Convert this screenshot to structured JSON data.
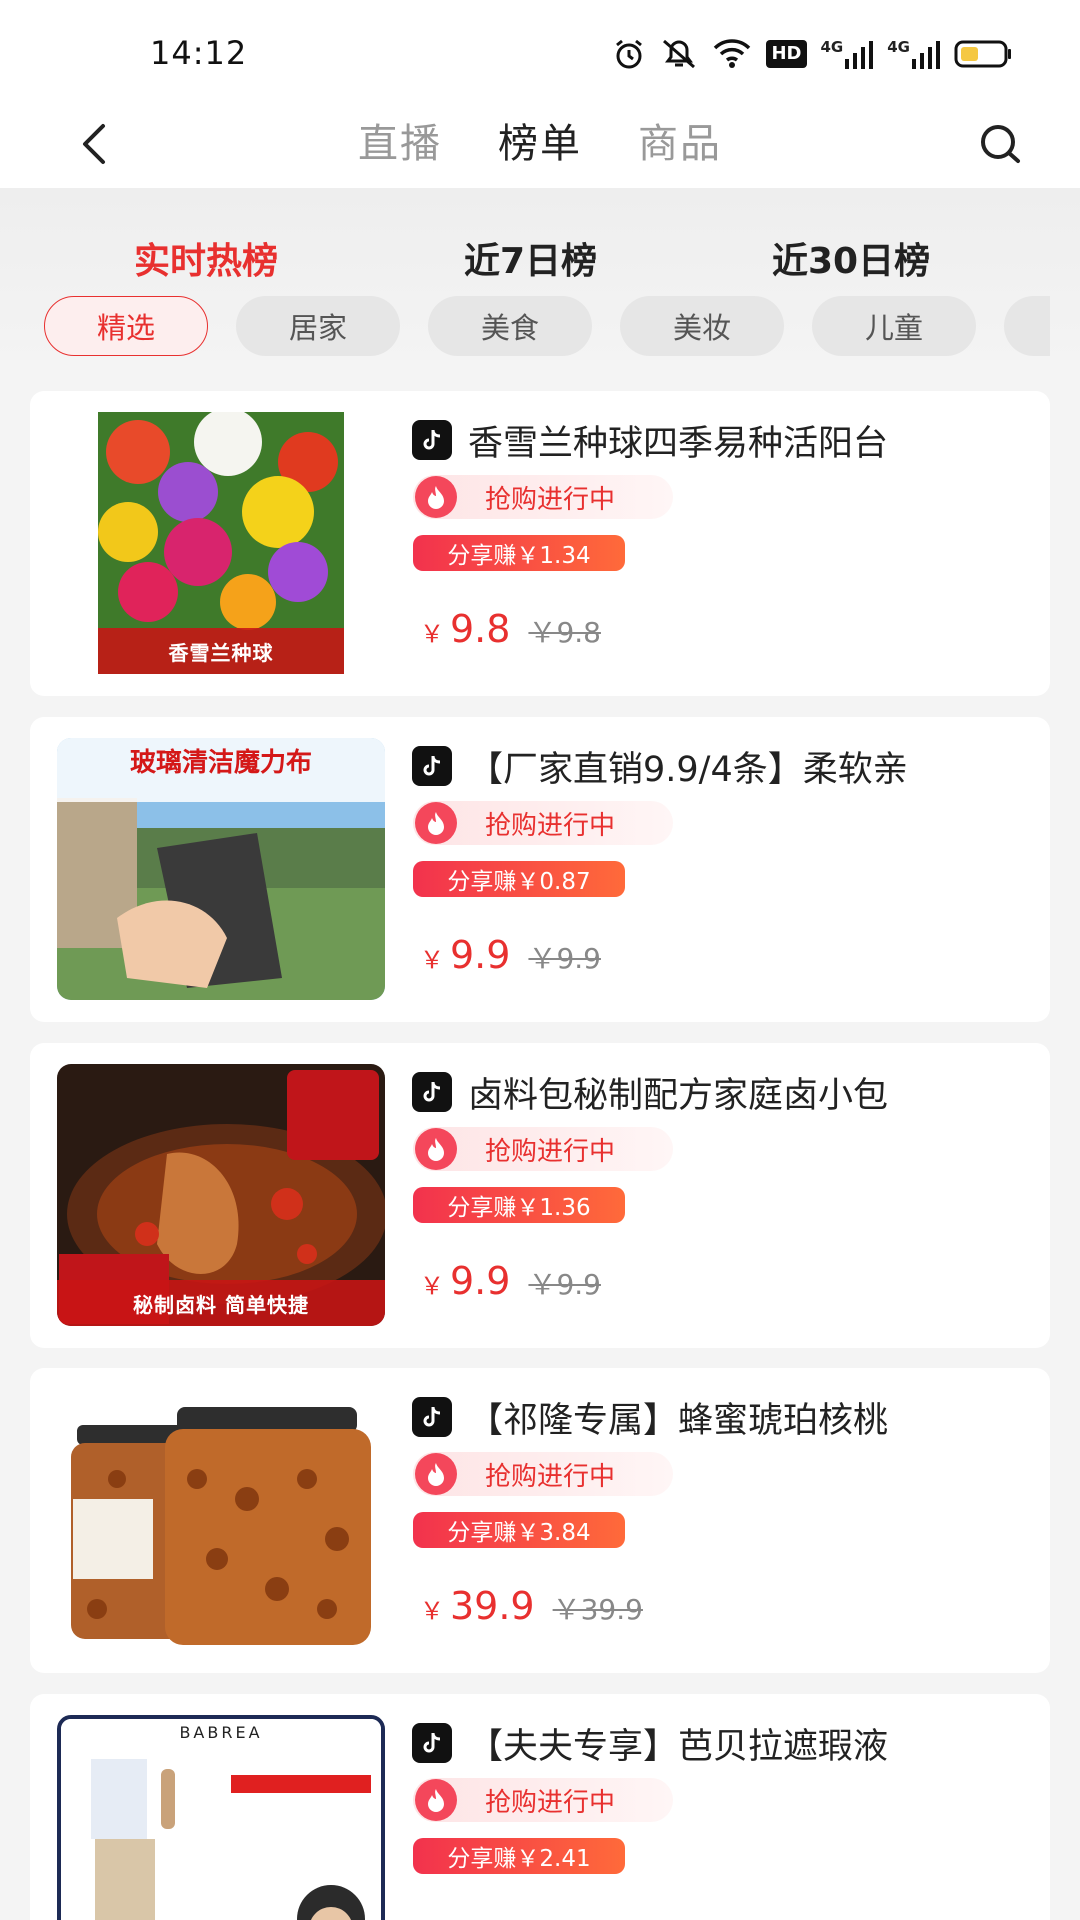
{
  "status_bar": {
    "time": "14:12",
    "net_badge": "HD",
    "signal_1": "4G",
    "signal_2": "4G"
  },
  "nav": {
    "tabs": [
      {
        "label": "直播"
      },
      {
        "label": "榜单"
      },
      {
        "label": "商品"
      }
    ],
    "active_tab": "榜单"
  },
  "rank_tabs": [
    {
      "label": "实时热榜"
    },
    {
      "label": "近7日榜"
    },
    {
      "label": "近30日榜"
    }
  ],
  "active_rank_tab": "实时热榜",
  "categories": [
    {
      "label": "精选"
    },
    {
      "label": "居家"
    },
    {
      "label": "美食"
    },
    {
      "label": "美妆"
    },
    {
      "label": "儿童"
    }
  ],
  "active_category": "精选",
  "products": [
    {
      "title": "香雪兰种球四季易种活阳台",
      "status": "抢购进行中",
      "share": "分享赚￥1.34",
      "currency": "￥",
      "price": "9.8",
      "original_price": "￥9.8",
      "image_text": "香雪兰种球"
    },
    {
      "title": "【厂家直销9.9/4条】柔软亲",
      "status": "抢购进行中",
      "share": "分享赚￥0.87",
      "currency": "￥",
      "price": "9.9",
      "original_price": "￥9.9",
      "image_text": "玻璃清洁魔力布"
    },
    {
      "title": "卤料包秘制配方家庭卤小包",
      "status": "抢购进行中",
      "share": "分享赚￥1.36",
      "currency": "￥",
      "price": "9.9",
      "original_price": "￥9.9",
      "image_text": "秘制卤料 简单快捷"
    },
    {
      "title": "【祁隆专属】蜂蜜琥珀核桃",
      "status": "抢购进行中",
      "share": "分享赚￥3.84",
      "currency": "￥",
      "price": "39.9",
      "original_price": "￥39.9",
      "image_text": ""
    },
    {
      "title": "【夫夫专享】芭贝拉遮瑕液",
      "status": "抢购进行中",
      "share": "分享赚￥2.41",
      "currency": "￥",
      "price": "",
      "original_price": "",
      "image_text": "BABREA"
    }
  ],
  "colors": {
    "accent": "#e8302f",
    "share_gradient_start": "#f2324d",
    "share_gradient_end": "#ff6a3a",
    "background": "#f4f4f4"
  },
  "icons": {
    "back": "chevron-left-icon",
    "search": "search-icon",
    "platform": "douyin-icon",
    "flash": "flame-icon"
  }
}
